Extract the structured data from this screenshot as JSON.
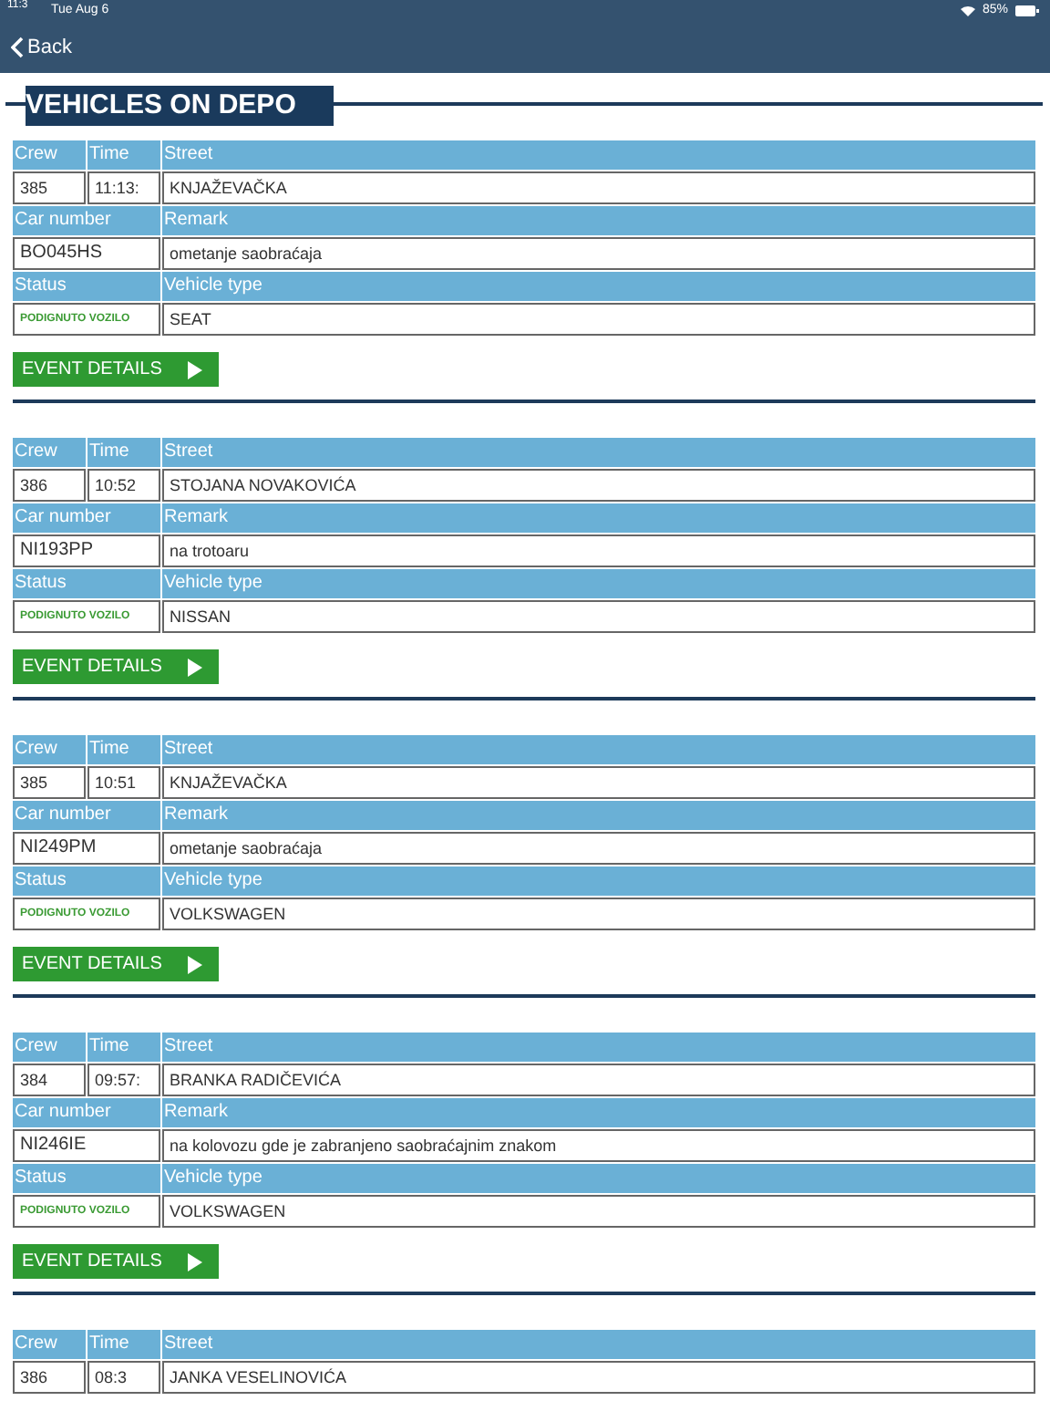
{
  "status_bar": {
    "time": "11:3",
    "date": "Tue Aug 6",
    "battery": "85%"
  },
  "nav": {
    "back": "Back"
  },
  "title": "VEHICLES ON DEPO",
  "vehicles": [
    {
      "fields": [
        {
          "label": "Crew",
          "value": "385"
        },
        {
          "label": "Time",
          "value": "11:13:"
        },
        {
          "label": "Street",
          "value": "KNJAŽEVAČKA"
        },
        {
          "label": "Car number",
          "value": "BO045HS"
        },
        {
          "label": "Remark",
          "value": "ometanje saobraćaja"
        },
        {
          "label": "Status",
          "value": "PODIGNUTO VOZILO"
        },
        {
          "label": "Vehicle type",
          "value": "SEAT"
        }
      ],
      "button": "EVENT DETAILS"
    },
    {
      "fields": [
        {
          "label": "Crew",
          "value": "386"
        },
        {
          "label": "Time",
          "value": "10:52"
        },
        {
          "label": "Street",
          "value": "STOJANA NOVAKOVIĆA"
        },
        {
          "label": "Car number",
          "value": "NI193PP"
        },
        {
          "label": "Remark",
          "value": "na trotoaru"
        },
        {
          "label": "Status",
          "value": "PODIGNUTO VOZILO"
        },
        {
          "label": "Vehicle type",
          "value": "NISSAN"
        }
      ],
      "button": "EVENT DETAILS"
    },
    {
      "fields": [
        {
          "label": "Crew",
          "value": "385"
        },
        {
          "label": "Time",
          "value": "10:51"
        },
        {
          "label": "Street",
          "value": "KNJAŽEVAČKA"
        },
        {
          "label": "Car number",
          "value": "NI249PM"
        },
        {
          "label": "Remark",
          "value": "ometanje saobraćaja"
        },
        {
          "label": "Status",
          "value": "PODIGNUTO VOZILO"
        },
        {
          "label": "Vehicle type",
          "value": "VOLKSWAGEN"
        }
      ],
      "button": "EVENT DETAILS"
    },
    {
      "fields": [
        {
          "label": "Crew",
          "value": "384"
        },
        {
          "label": "Time",
          "value": "09:57:"
        },
        {
          "label": "Street",
          "value": "BRANKA RADIČEVIĆA"
        },
        {
          "label": "Car number",
          "value": "NI246IE"
        },
        {
          "label": "Remark",
          "value": "na kolovozu gde je zabranjeno saobraćajnim znakom"
        },
        {
          "label": "Status",
          "value": "PODIGNUTO VOZILO"
        },
        {
          "label": "Vehicle type",
          "value": "VOLKSWAGEN"
        }
      ],
      "button": "EVENT DETAILS"
    },
    {
      "fields": [
        {
          "label": "Crew",
          "value": "386"
        },
        {
          "label": "Time",
          "value": "08:3"
        },
        {
          "label": "Street",
          "value": "JANKA VESELINOVIĆA"
        }
      ]
    }
  ]
}
